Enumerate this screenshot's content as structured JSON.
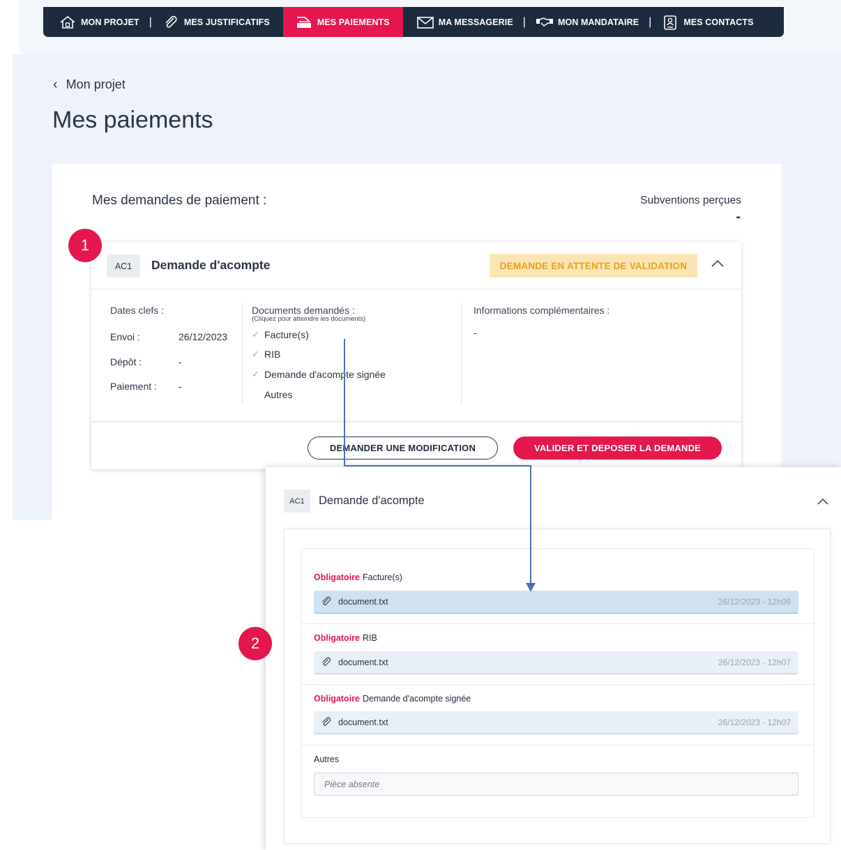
{
  "nav": {
    "items": [
      {
        "label": "MON PROJET",
        "icon": "house-icon"
      },
      {
        "label": "MES JUSTIFICATIFS",
        "icon": "paperclip-icon"
      },
      {
        "label": "MES PAIEMENTS",
        "icon": "payment-icon",
        "active": true
      },
      {
        "label": "MA MESSAGERIE",
        "icon": "envelope-icon"
      },
      {
        "label": "MON MANDATAIRE",
        "icon": "handshake-icon"
      },
      {
        "label": "MES CONTACTS",
        "icon": "contacts-icon"
      }
    ]
  },
  "breadcrumb": {
    "label": "Mon projet"
  },
  "page": {
    "title": "Mes paiements"
  },
  "section": {
    "title": "Mes demandes de paiement :",
    "subventions_label": "Subventions perçues",
    "subventions_value": "-"
  },
  "callouts": {
    "one": "1",
    "two": "2"
  },
  "request": {
    "code": "AC1",
    "title": "Demande d'acompte",
    "status": "DEMANDE EN ATTENTE DE VALIDATION",
    "dates_label": "Dates clefs :",
    "dates": [
      {
        "key": "Envoi :",
        "value": "26/12/2023"
      },
      {
        "key": "Dépôt :",
        "value": "-"
      },
      {
        "key": "Paiement :",
        "value": "-"
      }
    ],
    "documents_label": "Documents demandés :",
    "documents_hint": "(Cliquez pour atteindre les documents)",
    "documents": [
      {
        "label": "Facture(s)",
        "checked": true
      },
      {
        "label": "RIB",
        "checked": true
      },
      {
        "label": "Demande d'acompte signée",
        "checked": true
      },
      {
        "label": "Autres",
        "checked": false
      }
    ],
    "info_label": "Informations complémentaires :",
    "info_value": "-",
    "btn_modify": "DEMANDER UNE MODIFICATION",
    "btn_validate": "VALIDER ET DEPOSER LA DEMANDE"
  },
  "detail": {
    "code": "AC1",
    "title": "Demande d'acompte",
    "required_label": "Obligatoire",
    "docs": [
      {
        "name": "Facture(s)",
        "file": "document.txt",
        "date": "26/12/2023 - 12h06"
      },
      {
        "name": "RIB",
        "file": "document.txt",
        "date": "26/12/2023 - 12h07"
      },
      {
        "name": "Demande d'acompte signée",
        "file": "document.txt",
        "date": "26/12/2023 - 12h07"
      }
    ],
    "other_label": "Autres",
    "other_placeholder": "Pièce absente"
  },
  "colors": {
    "accent": "#e5174f",
    "nav_bg": "#1d2b3e",
    "status_bg": "#fbe5b4",
    "status_text": "#e9a11c",
    "arrow": "#4a72b8"
  }
}
